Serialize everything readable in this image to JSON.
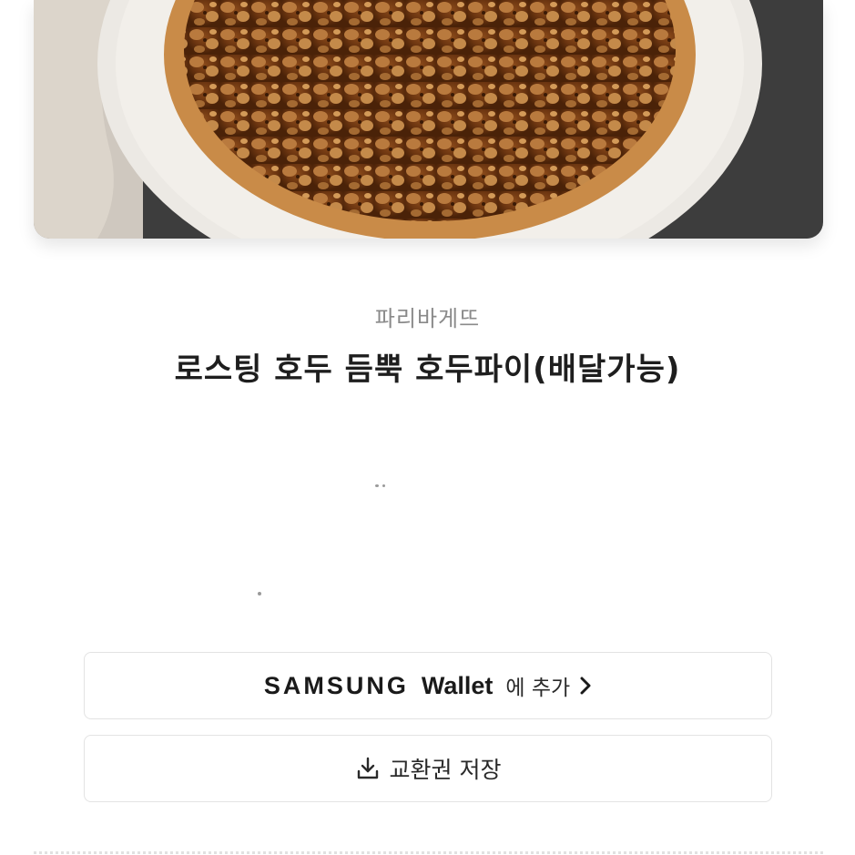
{
  "product": {
    "brand": "파리바게뜨",
    "title": "로스팅 호두 듬뿍 호두파이(배달가능)"
  },
  "actions": {
    "wallet_brand": "SAMSUNG",
    "wallet_name": "Wallet",
    "wallet_add": "에 추가",
    "save_label": "교환권 저장"
  },
  "icons": {
    "chevron": "chevron-right-icon",
    "download": "download-icon"
  },
  "colors": {
    "background": "#ffffff",
    "brand_text": "#8a8a8a",
    "title_text": "#1e1e1e",
    "button_border": "#e3e3e3"
  }
}
